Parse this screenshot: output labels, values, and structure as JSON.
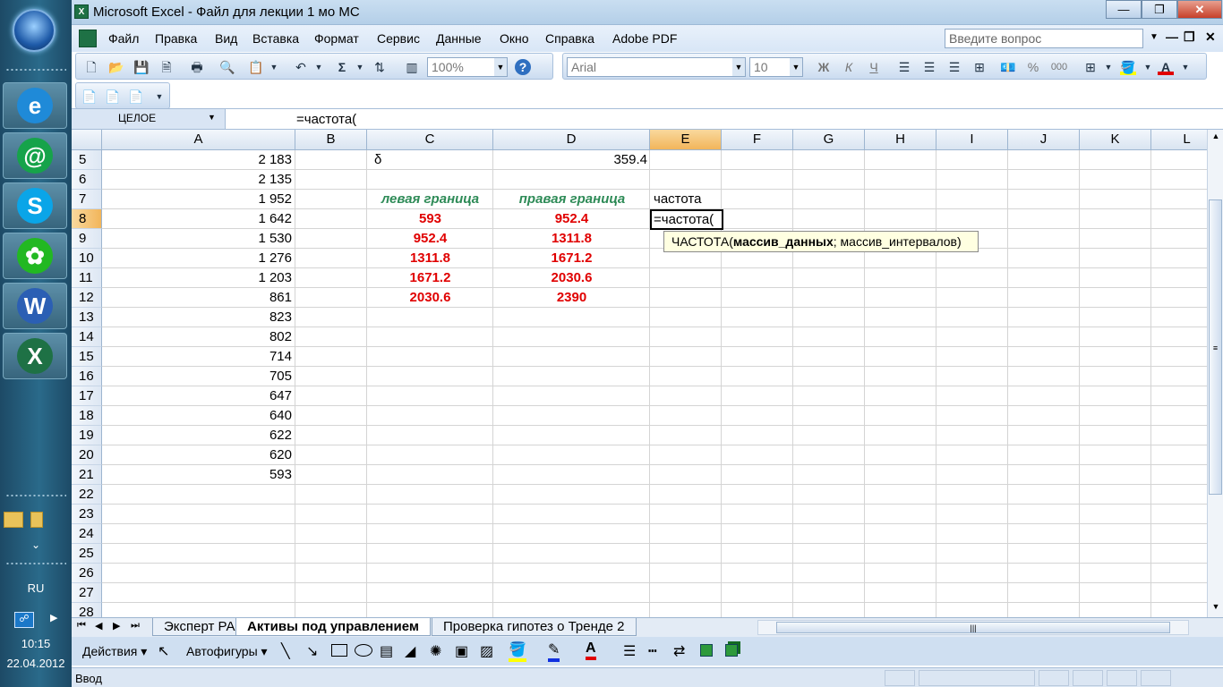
{
  "taskbar": {
    "apps": [
      {
        "name": "internet-explorer",
        "glyph": "e",
        "color": "#1f8ad8"
      },
      {
        "name": "mail-agent",
        "glyph": "@",
        "color": "#16a34a"
      },
      {
        "name": "skype",
        "glyph": "S",
        "color": "#0aa5e8"
      },
      {
        "name": "icq",
        "glyph": "✿",
        "color": "#22b822"
      },
      {
        "name": "word",
        "glyph": "W",
        "color": "#2b5fb4"
      },
      {
        "name": "excel",
        "glyph": "X",
        "color": "#1e7145"
      }
    ],
    "lang": "RU",
    "time": "10:15",
    "date": "22.04.2012",
    "expand_glyph": "⌄"
  },
  "window": {
    "icon_label": "X",
    "title": "Microsoft Excel - Файл для лекции 1 мо МС",
    "controls": [
      "—",
      "❐",
      "✕"
    ]
  },
  "menu": {
    "items": [
      "Файл",
      "Правка",
      "Вид",
      "Вставка",
      "Формат",
      "Сервис",
      "Данные",
      "Окно",
      "Справка",
      "Adobe PDF"
    ],
    "ask_placeholder": "Введите вопрос",
    "doc_controls": [
      "—",
      "❐",
      "✕"
    ]
  },
  "toolbar": {
    "zoom": "100%",
    "font": "Arial",
    "size": "10",
    "icons": [
      "new-icon",
      "open-icon",
      "save-icon",
      "permission-icon",
      "print-icon",
      "print-preview-icon",
      "paste-icon",
      "undo-icon",
      "autosum-icon",
      "sort-icon",
      "chart-icon",
      "help-icon"
    ],
    "format_buttons": [
      "Ж",
      "К",
      "Ч"
    ],
    "percent": "%",
    "thousands": "000"
  },
  "pdf_toolbar": {
    "icons": [
      "convert-to-pdf-icon",
      "convert-email-pdf-icon",
      "review-pdf-icon"
    ]
  },
  "formula_bar": {
    "name_box": "ЦЕЛОЕ",
    "formula": "=частота("
  },
  "sheet": {
    "columns": [
      "A",
      "B",
      "C",
      "D",
      "E",
      "F",
      "G",
      "H",
      "I",
      "J",
      "K",
      "L"
    ],
    "selected_column": "E",
    "rows": [
      "5",
      "6",
      "7",
      "8",
      "9",
      "10",
      "11",
      "12",
      "13",
      "14",
      "15",
      "16",
      "17",
      "18",
      "19",
      "20",
      "21",
      "22",
      "23",
      "24",
      "25",
      "26",
      "27",
      "28"
    ],
    "selected_row": "8",
    "col_a_values": [
      "2 183",
      "2 135",
      "1 952",
      "1 642",
      "1 530",
      "1 276",
      "1 203",
      "861",
      "823",
      "802",
      "714",
      "705",
      "647",
      "640",
      "622",
      "620",
      "593"
    ],
    "b5": "δ",
    "d5": "359.4",
    "c7": "левая граница",
    "d7": "правая граница",
    "e7": "частота",
    "left_bounds": [
      "593",
      "952.4",
      "1311.8",
      "1671.2",
      "2030.6"
    ],
    "right_bounds": [
      "952.4",
      "1311.8",
      "1671.2",
      "2030.6",
      "2390"
    ],
    "edit_value": "=частота(",
    "tooltip_fn": "ЧАСТОТА(",
    "tooltip_arg1": "массив_данных",
    "tooltip_rest": "; массив_интервалов)"
  },
  "tabs": {
    "nav": [
      "⏮",
      "◀",
      "▶",
      "⏭"
    ],
    "sheets": [
      {
        "label": "Эксперт РА",
        "active": false
      },
      {
        "label": "Активы под управлением",
        "active": true
      },
      {
        "label": "Проверка гипотез о Тренде 2",
        "active": false
      }
    ]
  },
  "drawing": {
    "actions": "Действия",
    "autoshapes": "Автофигуры"
  },
  "status": {
    "text": "Ввод"
  }
}
